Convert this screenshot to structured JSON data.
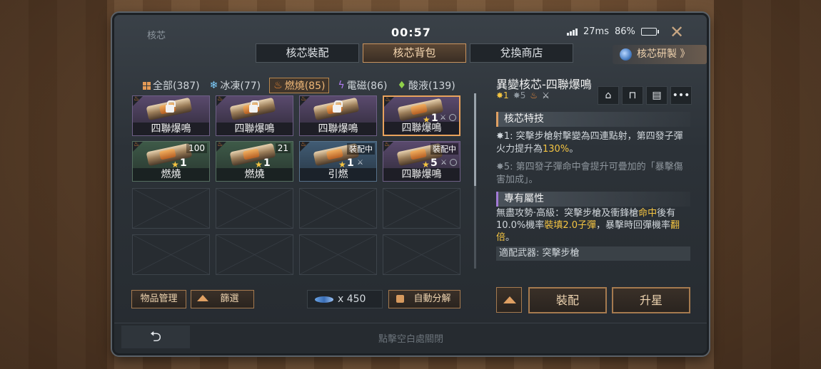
{
  "window": {
    "title": "核芯",
    "clock": "00:57",
    "ping": "27ms",
    "battery": "86%",
    "battery_level": 0.86,
    "close_icon": "close-icon"
  },
  "tabs": [
    {
      "label": "核芯裝配",
      "active": false
    },
    {
      "label": "核芯背包",
      "active": true
    },
    {
      "label": "兌換商店",
      "active": false
    }
  ],
  "research_button": {
    "label": "核芯研製 》",
    "icon": "orb-icon"
  },
  "filters": [
    {
      "label": "全部(387)",
      "icon": "grid-icon",
      "active": false
    },
    {
      "label": "冰凍(77)",
      "icon": "snowflake-icon",
      "active": false
    },
    {
      "label": "燃燒(85)",
      "icon": "fire-icon",
      "active": true
    },
    {
      "label": "電磁(86)",
      "icon": "lightning-icon",
      "active": false
    },
    {
      "label": "酸液(139)",
      "icon": "drop-icon",
      "active": false
    }
  ],
  "slots": [
    {
      "name": "四聯爆鳴",
      "rarity": "purple",
      "locked": true,
      "star": "",
      "level": "",
      "badge": ""
    },
    {
      "name": "四聯爆鳴",
      "rarity": "purple",
      "locked": true,
      "star": "",
      "level": "",
      "badge": ""
    },
    {
      "name": "四聯爆鳴",
      "rarity": "purple",
      "locked": true,
      "star": "",
      "level": "",
      "badge": ""
    },
    {
      "name": "四聯爆鳴",
      "rarity": "purple",
      "locked": false,
      "selected": true,
      "star": "★",
      "level": "1",
      "badge": ""
    },
    {
      "name": "燃燒",
      "rarity": "green",
      "star": "★",
      "level": "1",
      "badge": "100"
    },
    {
      "name": "燃燒",
      "rarity": "green",
      "star": "★",
      "level": "1",
      "badge": "21"
    },
    {
      "name": "引燃",
      "rarity": "blue",
      "star": "★",
      "level": "1",
      "badge": "裝配中"
    },
    {
      "name": "四聯爆鳴",
      "rarity": "purple",
      "star": "★",
      "level": "5",
      "badge": "裝配中"
    }
  ],
  "bottom": {
    "manage_label": "物品管理",
    "filter_label": "篩選",
    "currency_amount": "x 450",
    "decompose_label": "自動分解"
  },
  "detail": {
    "title": "異變核芯-四聯爆鳴",
    "tag_star1": "✸1",
    "tag_star5": "✸5",
    "skill_header": "核芯特技",
    "skill1_prefix": "✸1: 突擊步槍射擊變為四連點射，第四發子彈火力提升為",
    "skill1_value": "130%",
    "skill1_suffix": "。",
    "skill5": "✸5: 第四發子彈命中會提升可疊加的「暴擊傷害加成」。",
    "attr_header": "專有屬性",
    "attr_a": "無盡攻勢·高級：突擊步槍及衝鋒槍",
    "attr_b": "命中",
    "attr_c": "後有10.0%機率",
    "attr_d": "裝填2.0子彈",
    "attr_e": "，暴擊時回彈機率",
    "attr_f": "翻倍",
    "attr_g": "。",
    "weapon": "適配武器: 突擊步槍",
    "equip_label": "裝配",
    "star_label": "升星"
  },
  "footer": {
    "back_icon": "back-arrow-icon",
    "hint": "點擊空白處關閉"
  }
}
